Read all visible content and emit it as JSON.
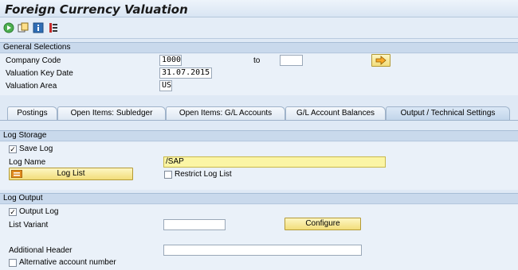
{
  "window": {
    "title": "Foreign Currency Valuation"
  },
  "toolbar": {
    "icons": [
      "execute-icon",
      "variant-icon",
      "info-icon",
      "selection-icon"
    ]
  },
  "general_selections": {
    "header": "General Selections",
    "company_code_label": "Company Code",
    "company_code_from": "1000",
    "to_label": "to",
    "company_code_to": "",
    "valuation_key_date_label": "Valuation Key Date",
    "valuation_key_date": "31.07.2015",
    "valuation_area_label": "Valuation Area",
    "valuation_area": "US"
  },
  "tabs": [
    {
      "label": "Postings"
    },
    {
      "label": "Open Items: Subledger"
    },
    {
      "label": "Open Items: G/L Accounts"
    },
    {
      "label": "G/L Account Balances"
    },
    {
      "label": "Output / Technical Settings",
      "active": true
    }
  ],
  "log_storage": {
    "header": "Log Storage",
    "save_log_label": "Save Log",
    "save_log_checked": true,
    "log_name_label": "Log Name",
    "log_name_value": "/SAP",
    "log_list_button": "Log List",
    "restrict_log_list_label": "Restrict Log List",
    "restrict_log_list_checked": false
  },
  "log_output": {
    "header": "Log Output",
    "output_log_label": "Output Log",
    "output_log_checked": true,
    "list_variant_label": "List Variant",
    "list_variant_value": "",
    "configure_button": "Configure",
    "additional_header_label": "Additional Header",
    "additional_header_value": "",
    "alt_account_label": "Alternative account number",
    "alt_account_checked": false
  }
}
